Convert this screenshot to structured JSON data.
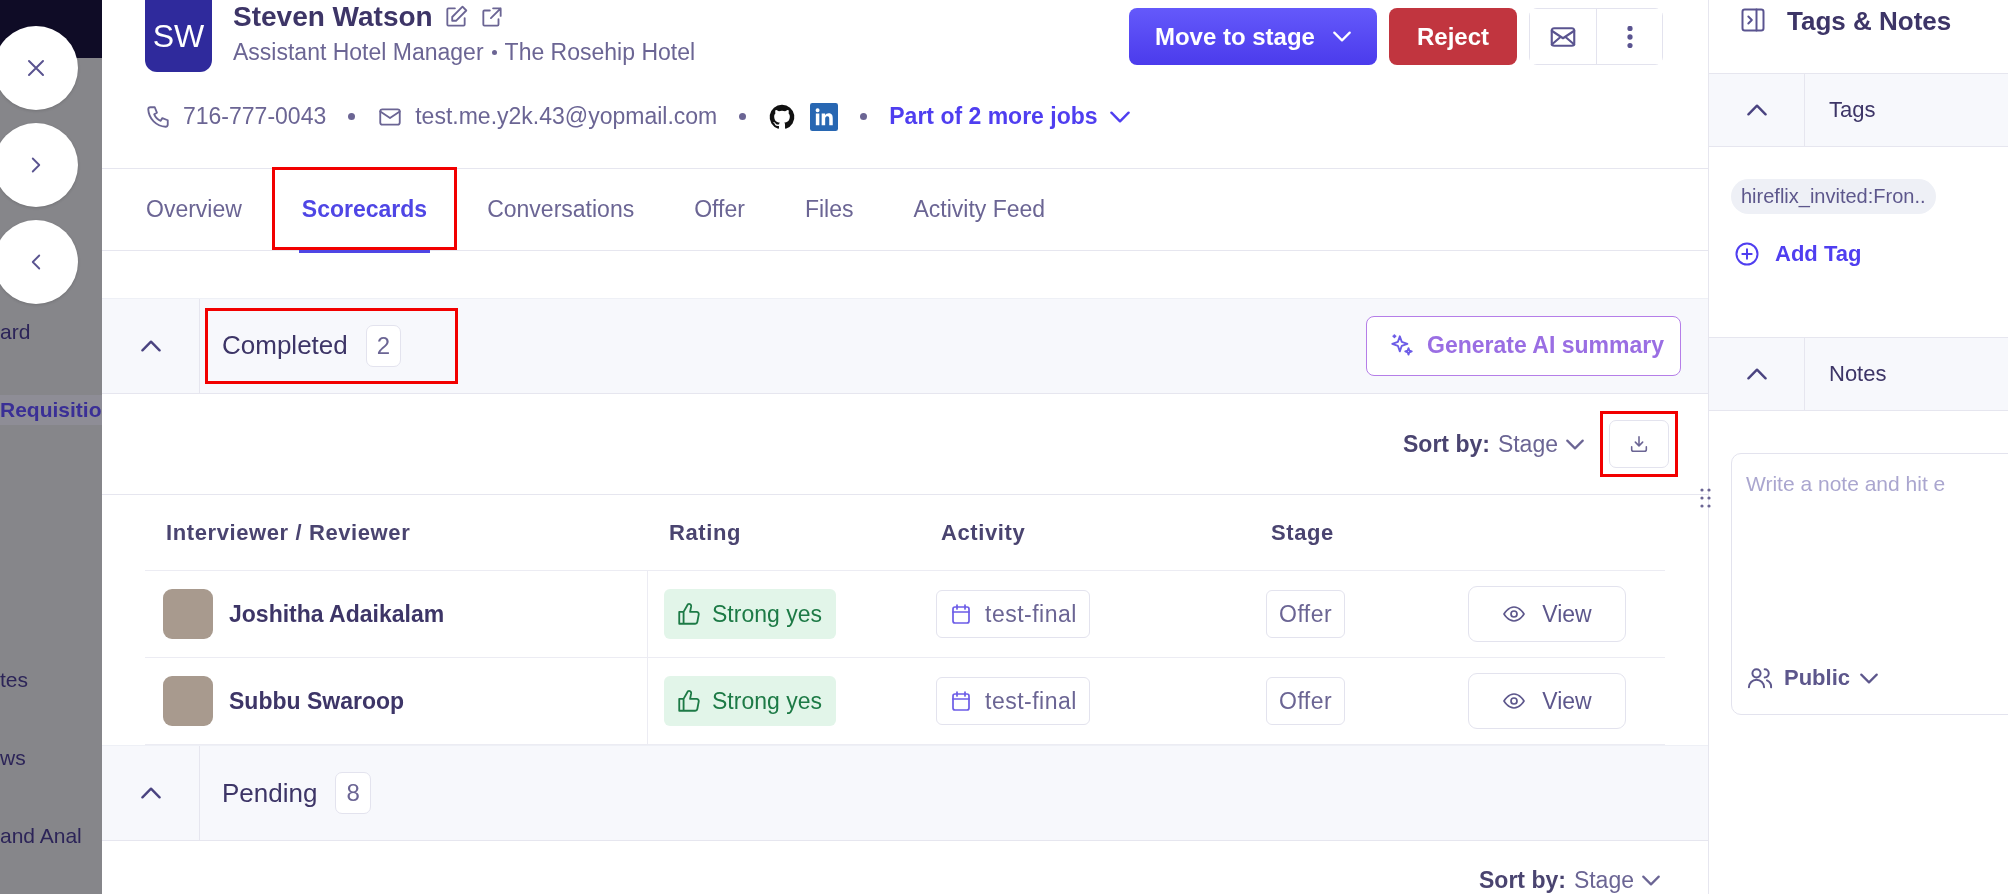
{
  "background_page": {
    "sidebar_groups": [
      [
        {
          "label": "ard",
          "selected": false
        },
        {
          "label": "Requisitio",
          "selected": true
        }
      ],
      [
        {
          "label": "tes",
          "selected": false
        },
        {
          "label": "ws",
          "selected": false
        },
        {
          "label": "and Anal",
          "selected": false
        }
      ]
    ]
  },
  "candidate": {
    "initials": "SW",
    "name": "Steven Watson",
    "title": "Assistant Hotel Manager",
    "company": "The Rosehip Hotel",
    "phone": "716-777-0043",
    "email": "test.me.y2k.43@yopmail.com",
    "more_jobs": "Part of 2 more jobs"
  },
  "actions": {
    "move_to_stage": "Move to stage",
    "reject": "Reject"
  },
  "tabs": [
    {
      "label": "Overview",
      "selected": false,
      "highlighted": false
    },
    {
      "label": "Scorecards",
      "selected": true,
      "highlighted": true
    },
    {
      "label": "Conversations",
      "selected": false,
      "highlighted": false
    },
    {
      "label": "Offer",
      "selected": false,
      "highlighted": false
    },
    {
      "label": "Files",
      "selected": false,
      "highlighted": false
    },
    {
      "label": "Activity Feed",
      "selected": false,
      "highlighted": false
    }
  ],
  "sections": [
    {
      "title": "Completed",
      "count": "2",
      "expanded": true,
      "highlighted": true,
      "ai_button": "Generate AI summary",
      "sort_label": "Sort by:",
      "sort_value": "Stage",
      "download_highlighted": true,
      "columns": [
        "Interviewer / Reviewer",
        "Rating",
        "Activity",
        "Stage"
      ],
      "rows": [
        {
          "reviewer": "Joshitha Adaikalam",
          "rating": "Strong yes",
          "activity": "test-final",
          "stage": "Offer",
          "action": "View"
        },
        {
          "reviewer": "Subbu Swaroop",
          "rating": "Strong yes",
          "activity": "test-final",
          "stage": "Offer",
          "action": "View"
        }
      ]
    },
    {
      "title": "Pending",
      "count": "8",
      "expanded": true,
      "highlighted": false,
      "sort_label": "Sort by:",
      "sort_value": "Stage"
    }
  ],
  "side_panel": {
    "title": "Tags & Notes",
    "tags_section": {
      "title": "Tags",
      "expanded": true,
      "tags": [
        "hireflix_invited:Fron.."
      ],
      "add_label": "Add Tag"
    },
    "notes_section": {
      "title": "Notes",
      "expanded": true,
      "placeholder": "Write a note and hit e",
      "visibility": "Public"
    }
  }
}
